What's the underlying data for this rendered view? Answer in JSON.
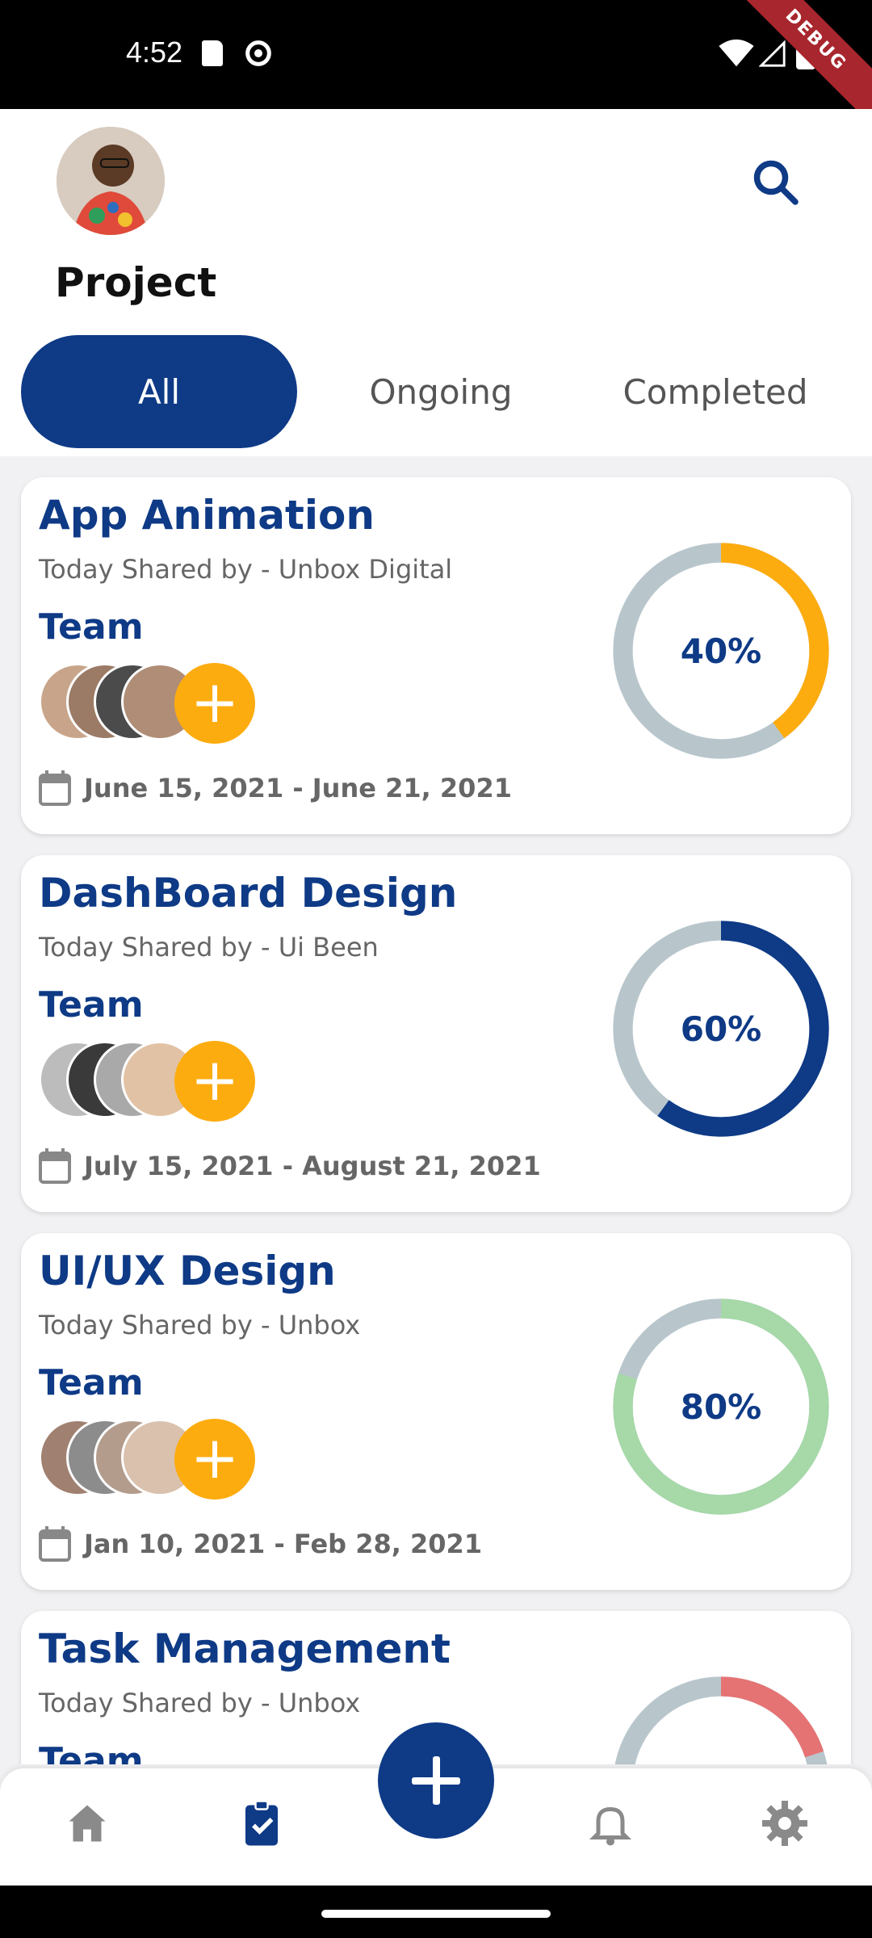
{
  "status_bar": {
    "time": "4:52",
    "debug_label": "DEBUG"
  },
  "header": {
    "title": "Project",
    "tabs": [
      {
        "label": "All",
        "active": true
      },
      {
        "label": "Ongoing",
        "active": false
      },
      {
        "label": "Completed",
        "active": false
      }
    ]
  },
  "projects": [
    {
      "title": "App Animation",
      "shared": "Today Shared by - Unbox Digital",
      "team_label": "Team",
      "dates": "June 15, 2021 - June 21, 2021",
      "progress": 40,
      "progress_label": "40%",
      "ring_color": "#fdac0f"
    },
    {
      "title": "DashBoard Design",
      "shared": "Today Shared by - Ui Been",
      "team_label": "Team",
      "dates": "July 15, 2021 - August 21, 2021",
      "progress": 60,
      "progress_label": "60%",
      "ring_color": "#0e3a86"
    },
    {
      "title": "UI/UX Design",
      "shared": "Today Shared by - Unbox",
      "team_label": "Team",
      "dates": "Jan 10, 2021 - Feb 28, 2021",
      "progress": 80,
      "progress_label": "80%",
      "ring_color": "#a6d8a8"
    },
    {
      "title": "Task Management",
      "shared": "Today Shared by - Unbox",
      "team_label": "Team",
      "dates": "",
      "progress": 20,
      "progress_label": "",
      "ring_color": "#e57373"
    }
  ],
  "nav": {
    "items": [
      "home-icon",
      "clipboard-check-icon",
      "bell-icon",
      "gear-icon"
    ],
    "fab_icon": "plus-icon"
  },
  "colors": {
    "primary": "#0e3a86",
    "accent": "#fdac0f",
    "track": "#b8c6cc"
  }
}
